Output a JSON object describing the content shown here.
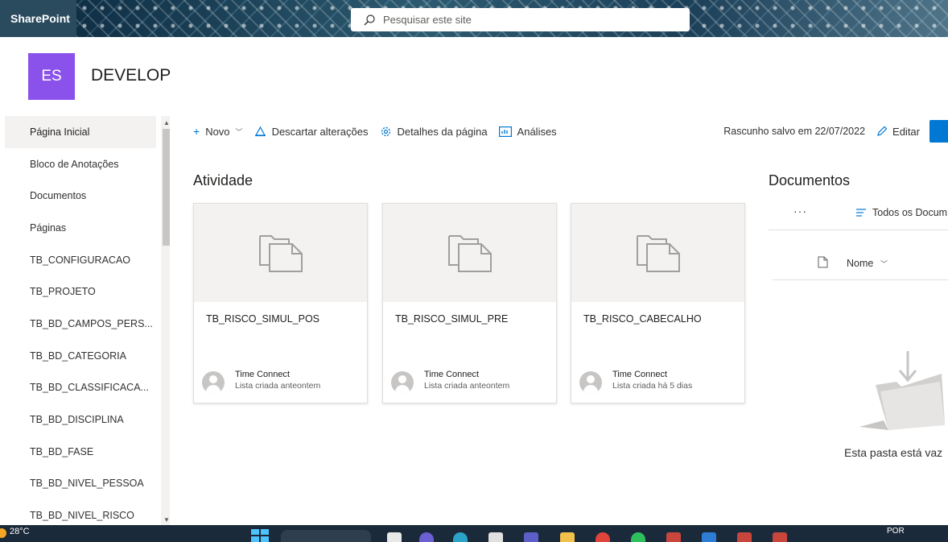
{
  "topbar": {
    "brand": "SharePoint",
    "search_placeholder": "Pesquisar este site"
  },
  "site": {
    "logo_initials": "ES",
    "title": "DEVELOP",
    "logo_color": "#8a52ea"
  },
  "nav": {
    "items": [
      {
        "label": "Página Inicial",
        "selected": true
      },
      {
        "label": "Bloco de Anotações"
      },
      {
        "label": "Documentos"
      },
      {
        "label": "Páginas"
      },
      {
        "label": "TB_CONFIGURACAO"
      },
      {
        "label": "TB_PROJETO"
      },
      {
        "label": "TB_BD_CAMPOS_PERS..."
      },
      {
        "label": "TB_BD_CATEGORIA"
      },
      {
        "label": "TB_BD_CLASSIFICACA..."
      },
      {
        "label": "TB_BD_DISCIPLINA"
      },
      {
        "label": "TB_BD_FASE"
      },
      {
        "label": "TB_BD_NIVEL_PESSOA"
      },
      {
        "label": "TB_BD_NIVEL_RISCO"
      }
    ]
  },
  "commandbar": {
    "new_label": "Novo",
    "discard_label": "Descartar alterações",
    "details_label": "Detalhes da página",
    "analytics_label": "Análises",
    "draft_status": "Rascunho salvo em 22/07/2022",
    "edit_label": "Editar",
    "accent_color": "#0078d4"
  },
  "activity": {
    "title": "Atividade",
    "cards": [
      {
        "title": "TB_RISCO_SIMUL_POS",
        "author": "Time Connect",
        "subtitle": "Lista criada anteontem"
      },
      {
        "title": "TB_RISCO_SIMUL_PRE",
        "author": "Time Connect",
        "subtitle": "Lista criada anteontem"
      },
      {
        "title": "TB_RISCO_CABECALHO",
        "author": "Time Connect",
        "subtitle": "Lista criada há 5 dias"
      }
    ]
  },
  "documents": {
    "title": "Documentos",
    "more_label": "···",
    "view_label": "Todos os Docum",
    "column_name": "Nome",
    "empty_text": "Esta pasta está vaz"
  },
  "taskbar": {
    "temperature": "28°C",
    "language": "POR"
  }
}
